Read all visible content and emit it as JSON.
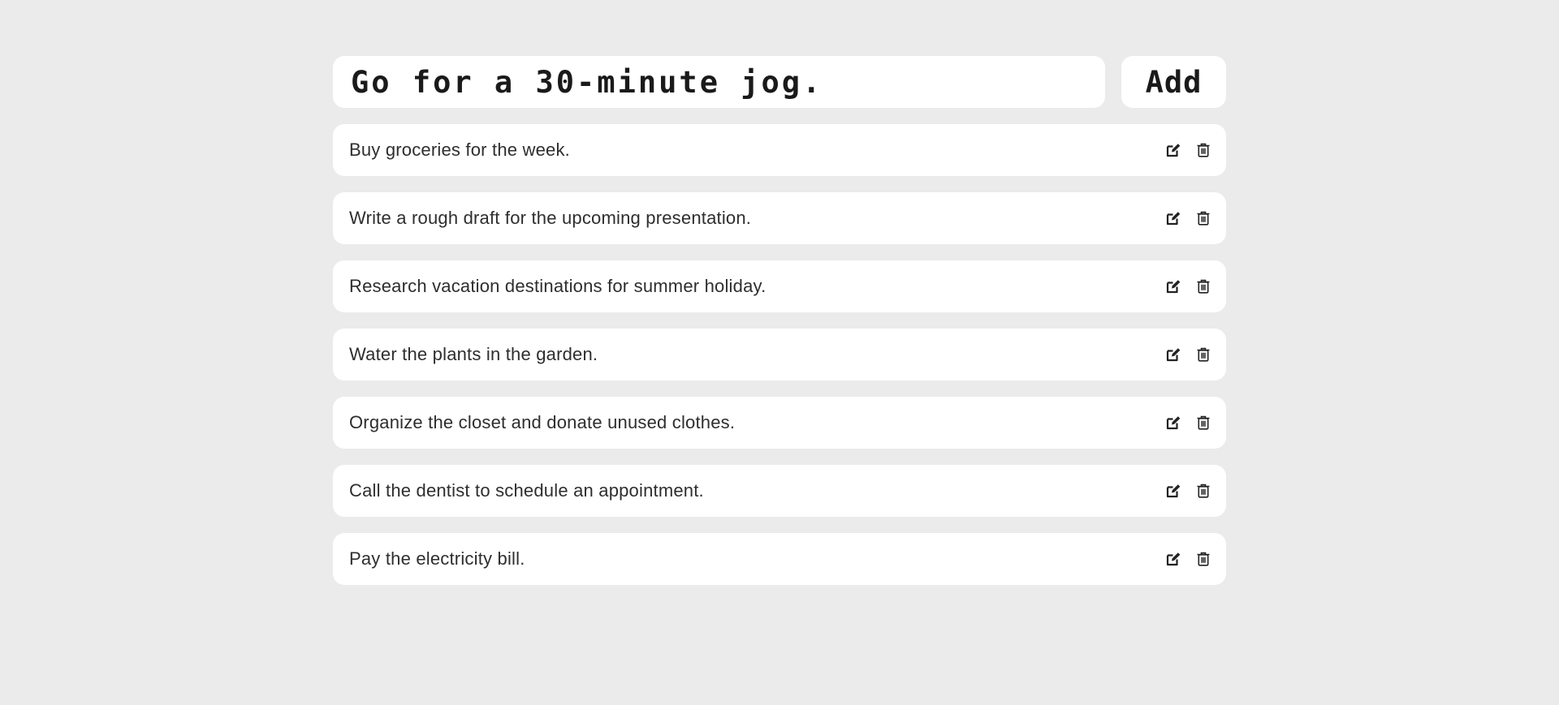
{
  "entry": {
    "value": "Go for a 30-minute jog.",
    "add_label": "Add"
  },
  "todos": [
    {
      "text": "Buy groceries for the week.",
      "edit_icon": "edit-icon",
      "delete_icon": "trash-icon"
    },
    {
      "text": "Write a rough draft for the upcoming presentation.",
      "edit_icon": "edit-icon",
      "delete_icon": "trash-icon"
    },
    {
      "text": "Research vacation destinations for summer holiday.",
      "edit_icon": "edit-icon",
      "delete_icon": "trash-icon"
    },
    {
      "text": "Water the plants in the garden.",
      "edit_icon": "edit-icon",
      "delete_icon": "trash-icon"
    },
    {
      "text": "Organize the closet and donate unused clothes.",
      "edit_icon": "edit-icon",
      "delete_icon": "trash-icon"
    },
    {
      "text": "Call the dentist to schedule an appointment.",
      "edit_icon": "edit-icon",
      "delete_icon": "trash-icon"
    },
    {
      "text": "Pay the electricity bill.",
      "edit_icon": "edit-icon",
      "delete_icon": "trash-icon"
    }
  ],
  "colors": {
    "background": "#ebebeb",
    "card": "#ffffff",
    "text": "#2e2e2e"
  }
}
